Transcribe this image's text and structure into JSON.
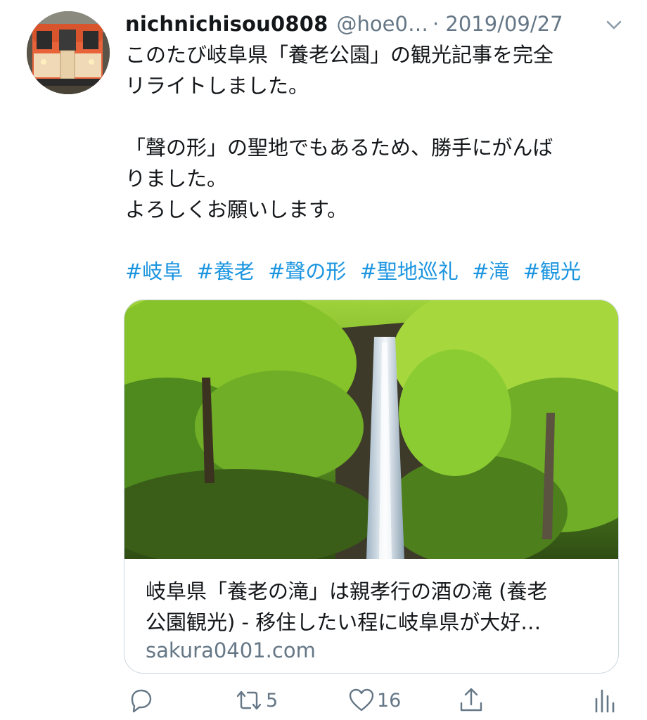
{
  "tweet": {
    "display_name": "nichnichisou0808",
    "handle": "@hoe0…",
    "date": "· 2019/09/27",
    "text_lines": [
      "このたび岐阜県「養老公園」の観光記事を完全",
      "リライトしました。",
      "",
      "「聲の形」の聖地でもあるため、勝手にがんば",
      "りました。",
      "よろしくお願いします。"
    ],
    "hashtags": [
      "#岐阜",
      "#養老",
      "#聲の形",
      "#聖地巡礼",
      "#滝",
      "#観光"
    ]
  },
  "card": {
    "title_line1": "岐阜県「養老の滝」は親孝行の酒の滝 (養老",
    "title_line2": "公園観光) - 移住したい程に岐阜県が大好…",
    "domain": "sakura0401.com"
  },
  "actions": {
    "reply_icon": "reply-icon",
    "retweet_icon": "retweet-icon",
    "retweet_count": "5",
    "like_icon": "heart-icon",
    "like_count": "16",
    "share_icon": "share-icon",
    "analytics_icon": "analytics-icon"
  },
  "colors": {
    "text": "#14171a",
    "secondary": "#657786",
    "link": "#1b95e0",
    "border": "#ccd6dd"
  }
}
